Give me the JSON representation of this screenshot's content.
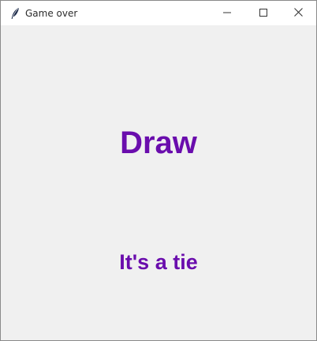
{
  "window": {
    "title": "Game over",
    "app_icon": "feather-icon",
    "controls": {
      "minimize_icon": "minimize-icon",
      "maximize_icon": "maximize-icon",
      "close_icon": "close-icon"
    }
  },
  "main": {
    "result_text": "Draw",
    "detail_text": "It's a tie"
  },
  "colors": {
    "accent": "#6a0dad",
    "background": "#f0f0f0",
    "titlebar": "#ffffff"
  }
}
